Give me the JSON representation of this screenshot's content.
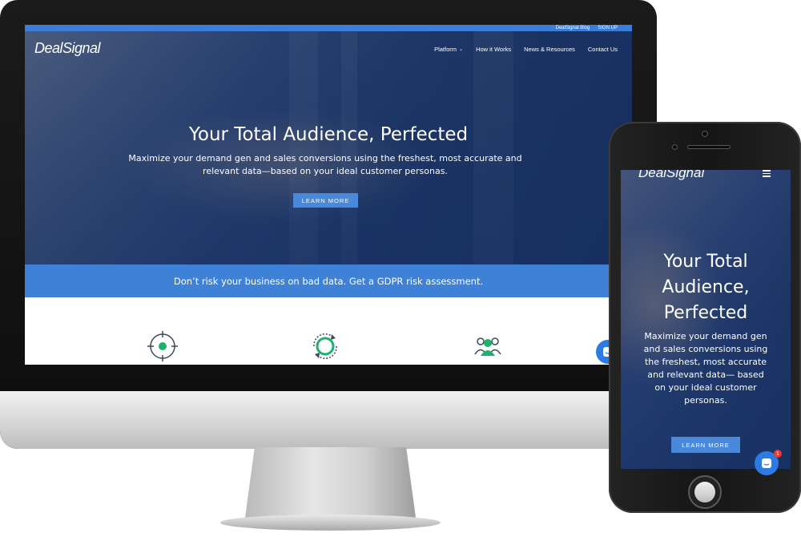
{
  "desktop": {
    "topbar": {
      "links": [
        "DealSignal Blog",
        "SIGN UP"
      ]
    },
    "logo": "DealSignal",
    "nav": {
      "items": [
        "Platform",
        "How it Works",
        "News & Resources",
        "Contact Us"
      ]
    },
    "hero": {
      "title": "Your Total Audience, Perfected",
      "subtitle": "Maximize your demand gen and sales conversions using the freshest, most accurate and relevant data—based on your ideal customer personas.",
      "cta": "LEARN MORE"
    },
    "gdpr_banner": "Don’t risk your business on bad data. Get a GDPR risk assessment.",
    "feature_icons": [
      "target-icon",
      "refresh-cycle-icon",
      "people-group-icon"
    ],
    "colors": {
      "accent": "#3f81d6",
      "button": "#4a89da",
      "icon_green": "#1fb06b"
    }
  },
  "mobile": {
    "logo": "DealSignal",
    "hero": {
      "title": "Your Total Audience, Perfected",
      "subtitle": "Maximize your demand gen and sales conversions using the freshest, most accurate and relevant data— based on your ideal customer personas.",
      "cta": "LEARN MORE"
    },
    "chat_badge_count": "1"
  }
}
